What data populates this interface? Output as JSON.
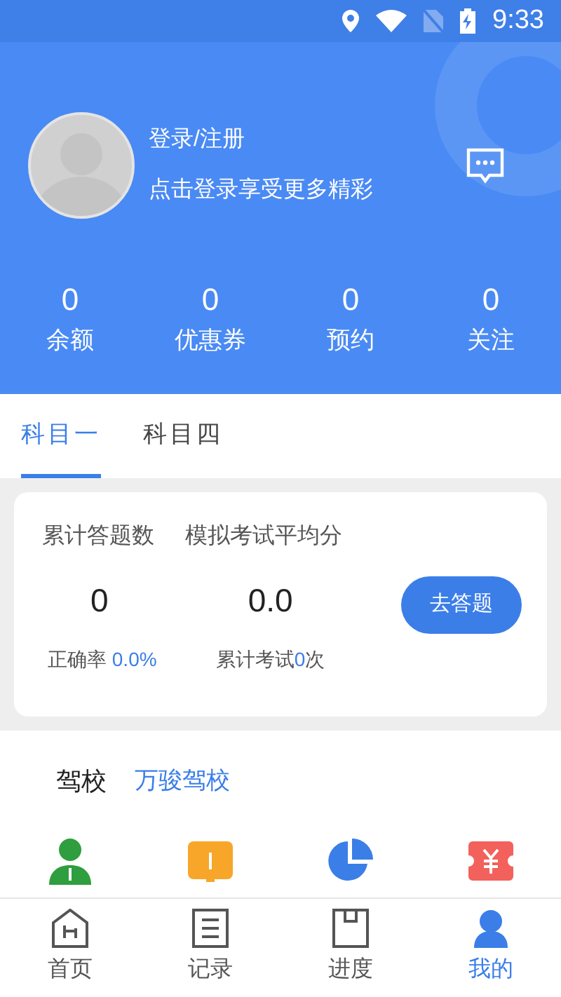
{
  "status_bar": {
    "time": "9:33"
  },
  "profile": {
    "title": "登录/注册",
    "subtitle": "点击登录享受更多精彩"
  },
  "stats": [
    {
      "value": "0",
      "label": "余额"
    },
    {
      "value": "0",
      "label": "优惠券"
    },
    {
      "value": "0",
      "label": "预约"
    },
    {
      "value": "0",
      "label": "关注"
    }
  ],
  "tabs": [
    {
      "label": "科目一",
      "selected": true
    },
    {
      "label": "科目四",
      "selected": false
    }
  ],
  "card": {
    "col_1": {
      "label": "累计答题数",
      "value": "0",
      "note": "正确率",
      "note_value": "0.0%"
    },
    "col_2": {
      "label": "模拟考试平均分",
      "value": "0.0",
      "note_before": "累计考试",
      "note_value": "0",
      "note_after": "次"
    },
    "button": "去答题"
  },
  "school": {
    "label": "驾校",
    "name": "万骏驾校"
  },
  "shortcuts": [
    {
      "kind": "person"
    },
    {
      "kind": "book"
    },
    {
      "kind": "pie"
    },
    {
      "kind": "ticket"
    }
  ],
  "bottom_nav": [
    {
      "label": "首页",
      "kind": "home",
      "selected": false
    },
    {
      "label": "记录",
      "kind": "list",
      "selected": false
    },
    {
      "label": "进度",
      "kind": "box",
      "selected": false
    },
    {
      "label": "我的",
      "kind": "user",
      "selected": true
    }
  ]
}
